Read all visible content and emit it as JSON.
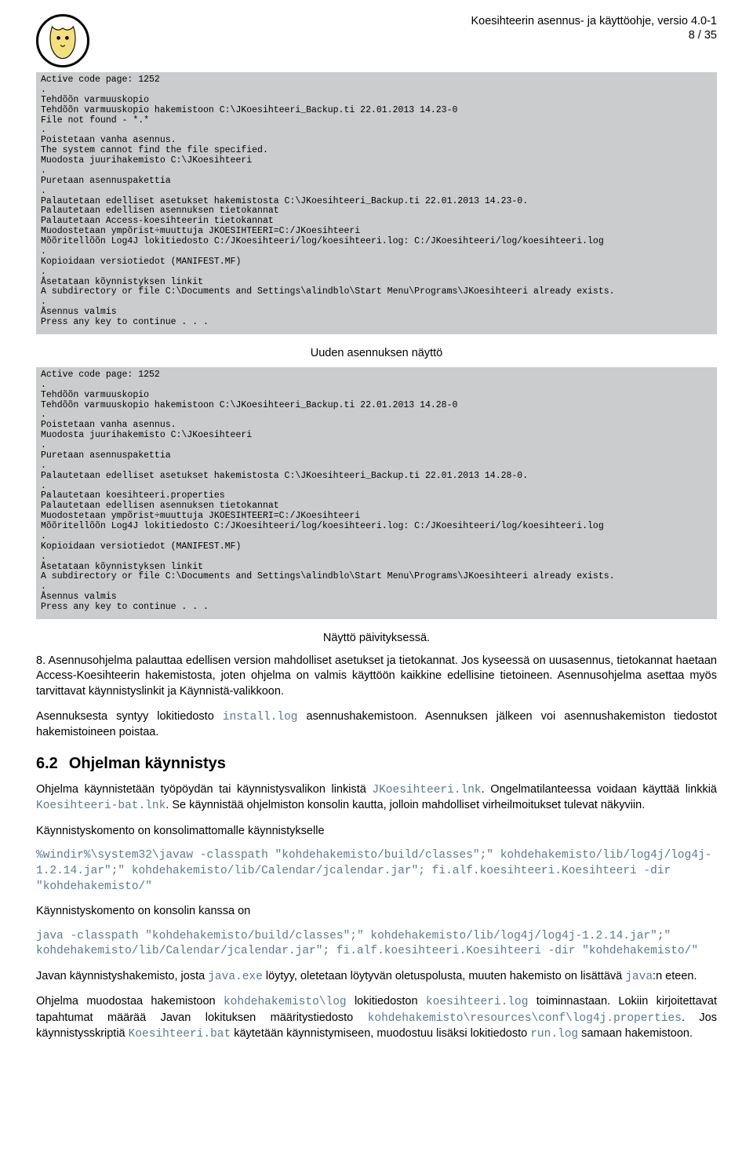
{
  "header": {
    "title": "Koesihteerin asennus- ja käyttöohje, versio 4.0-1",
    "pageno": "8 / 35"
  },
  "term1": "Active code page: 1252\n.\nTehdõõn varmuuskopio\nTehdõõn varmuuskopio hakemistoon C:\\JKoesihteeri_Backup.ti 22.01.2013 14.23-0\nFile not found - *.*\n.\nPoistetaan vanha asennus.\nThe system cannot find the file specified.\nMuodosta juurihakemisto C:\\JKoesihteeri\n.\nPuretaan asennuspakettia\n.\nPalautetaan edelliset asetukset hakemistosta C:\\JKoesihteeri_Backup.ti 22.01.2013 14.23-0.\nPalautetaan edellisen asennuksen tietokannat\nPalautetaan Access-koesihteerin tietokannat\nMuodostetaan ympõrist÷muuttuja JKOESIHTEERI=C:/JKoesihteeri\nMõõritellõõn Log4J lokitiedosto C:/JKoesihteeri/log/koesihteeri.log: C:/JKoesihteeri/log/koesihteeri.log\n.\nKopioidaan versiotiedot (MANIFEST.MF)\n.\nÅsetataan kõynnistyksen linkit\nA subdirectory or file C:\\Documents and Settings\\alindblo\\Start Menu\\Programs\\JKoesihteeri already exists.\n.\nÅsennus valmis\nPress any key to continue . . .",
  "caption1": "Uuden asennuksen näyttö",
  "term2": "Active code page: 1252\n.\nTehdõõn varmuuskopio\nTehdõõn varmuuskopio hakemistoon C:\\JKoesihteeri_Backup.ti 22.01.2013 14.28-0\n.\nPoistetaan vanha asennus.\nMuodosta juurihakemisto C:\\JKoesihteeri\n.\nPuretaan asennuspakettia\n.\nPalautetaan edelliset asetukset hakemistosta C:\\JKoesihteeri_Backup.ti 22.01.2013 14.28-0.\n.\nPalautetaan koesihteeri.properties\nPalautetaan edellisen asennuksen tietokannat\nMuodostetaan ympõrist÷muuttuja JKOESIHTEERI=C:/JKoesihteeri\nMõõritellõõn Log4J lokitiedosto C:/JKoesihteeri/log/koesihteeri.log: C:/JKoesihteeri/log/koesihteeri.log\n.\nKopioidaan versiotiedot (MANIFEST.MF)\n.\nÅsetataan kõynnistyksen linkit\nA subdirectory or file C:\\Documents and Settings\\alindblo\\Start Menu\\Programs\\JKoesihteeri already exists.\n.\nÅsennus valmis\nPress any key to continue . . .",
  "caption2": "Näyttö päivityksessä.",
  "p8": {
    "pre": "8.  Asennusohjelma palauttaa edellisen version mahdolliset asetukset ja tietokannat. Jos kyseessä on uusasennus, tietokannat haetaan Access-Koesihteerin hakemistosta, joten ohjelma on valmis käyttöön kaikkine edellisine tietoineen. Asennusohjelma asettaa myös tarvittavat käynnistyslinkit ja Käynnistä-valikkoon."
  },
  "plog": {
    "a": "Asennuksesta syntyy lokitiedosto ",
    "c1": "install.log",
    "b": " asennushakemistoon. Asennuksen jälkeen voi asennushakemiston tiedostot hakemistoineen poistaa."
  },
  "h62": {
    "num": "6.2",
    "title": "Ohjelman käynnistys"
  },
  "pstart": {
    "a": "Ohjelma käynnistetään työpöydän tai käynnistysvalikon linkistä ",
    "c1": "JKoesihteeri.lnk",
    "b": ". Ongelmatilanteessa voidaan käyttää linkkiä ",
    "c2": "Koesihteeri-bat.lnk",
    "c": ". Se käynnistää ohjelmiston konsolin kautta, jolloin mahdolliset virheilmoitukset tulevat näkyviin."
  },
  "pk1": "Käynnistyskomento on konsolimattomalle käynnistykselle",
  "cmd1": "%windir%\\system32\\javaw -classpath \"kohdehakemisto/build/classes\";\" kohdehakemisto/lib/log4j/log4j-1.2.14.jar\";\" kohdehakemisto/lib/Calendar/jcalendar.jar\"; fi.alf.koesihteeri.Koesihteeri -dir \"kohdehakemisto/\"",
  "pk2": "Käynnistyskomento on konsolin kanssa on",
  "cmd2": "java -classpath \"kohdehakemisto/build/classes\";\" kohdehakemisto/lib/log4j/log4j-1.2.14.jar\";\" kohdehakemisto/lib/Calendar/jcalendar.jar\"; fi.alf.koesihteeri.Koesihteeri -dir \"kohdehakemisto/\"",
  "pjava": {
    "a": "Javan käynnistyshakemisto, josta ",
    "c1": "java.exe",
    "b": " löytyy, oletetaan löytyvän oletuspolusta, muuten hakemisto on lisättävä ",
    "c2": "java",
    "c": ":n eteen."
  },
  "pend": {
    "a": "Ohjelma muodostaa hakemistoon ",
    "c1": "kohdehakemisto\\log",
    "b": " lokitiedoston ",
    "c2": "koesihteeri.log",
    "c": " toiminnastaan. Lokiin kirjoitettavat tapahtumat määrää Javan lokituksen määritystiedosto ",
    "c3": "kohdehakemisto\\resources\\conf\\log4j.properties",
    "d": ". Jos käynnistysskriptiä ",
    "c4": "Koesihteeri.bat",
    "e": " käytetään käynnistymiseen, muodostuu lisäksi lokitiedosto ",
    "c5": "run.log",
    "f": " samaan hakemistoon."
  }
}
